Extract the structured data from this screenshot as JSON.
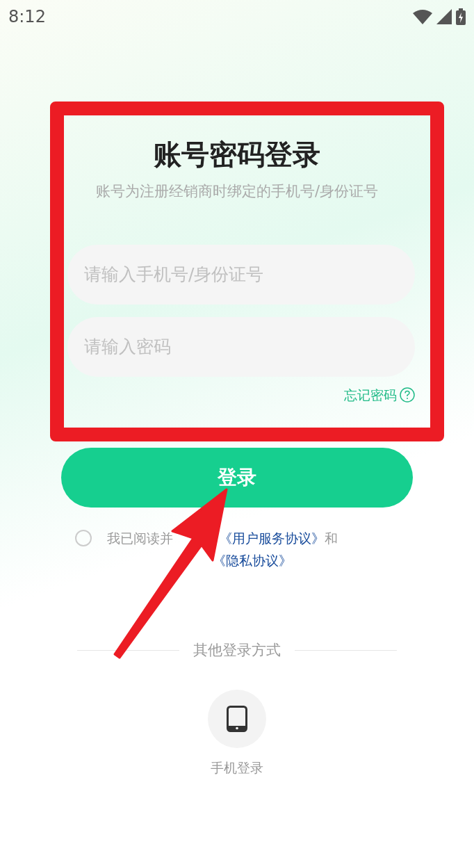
{
  "status_bar": {
    "time": "8:12"
  },
  "title": "账号密码登录",
  "subtitle": "账号为注册经销商时绑定的手机号/身份证号",
  "fields": [
    {
      "placeholder": "请输入手机号/身份证号"
    },
    {
      "placeholder": "请输入密码"
    }
  ],
  "forgot_password": "忘记密码",
  "login_button": "登录",
  "agreement": {
    "checked": false,
    "prefix": "我已阅读并",
    "link_1": "《用户服务协议》",
    "joiner": "和",
    "link_2": "《隐私协议》"
  },
  "other_login": {
    "label": "其他登录方式",
    "methods": [
      {
        "label": "手机登录"
      }
    ]
  }
}
